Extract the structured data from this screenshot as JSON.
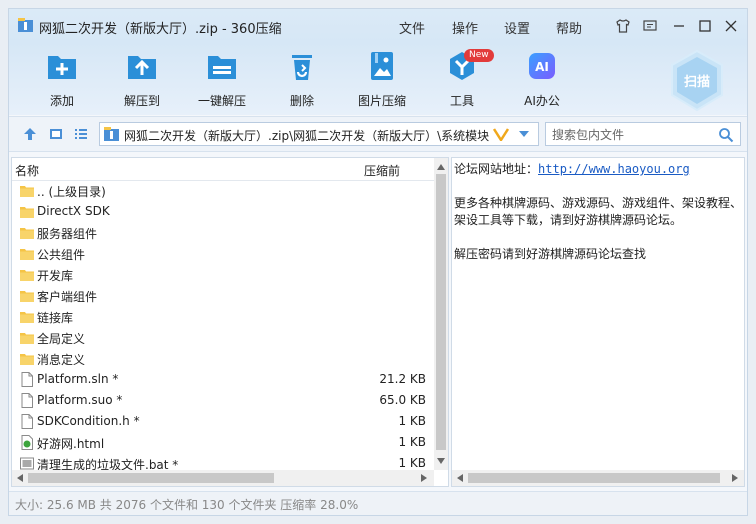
{
  "window": {
    "title": "网狐二次开发（新版大厅）.zip - 360压缩"
  },
  "menu": [
    "文件",
    "操作",
    "设置",
    "帮助"
  ],
  "toolbar": [
    {
      "label": "添加",
      "icon": "add-icon"
    },
    {
      "label": "解压到",
      "icon": "extract-to-icon"
    },
    {
      "label": "一键解压",
      "icon": "one-click-extract-icon"
    },
    {
      "label": "删除",
      "icon": "delete-icon"
    },
    {
      "label": "图片压缩",
      "icon": "image-compress-icon"
    },
    {
      "label": "工具",
      "icon": "tools-icon",
      "badge": "New"
    },
    {
      "label": "AI办公",
      "icon": "ai-office-icon",
      "glyph": "AI"
    }
  ],
  "scan": {
    "label": "扫描"
  },
  "nav": {
    "path": "网狐二次开发（新版大厅）.zip\\网狐二次开发（新版大厅）\\系统模块",
    "search_placeholder": "搜索包内文件"
  },
  "columns": {
    "name": "名称",
    "size": "压缩前"
  },
  "files": [
    {
      "name": ".. (上级目录)",
      "size": "",
      "type": "folder"
    },
    {
      "name": "DirectX SDK",
      "size": "",
      "type": "folder"
    },
    {
      "name": "服务器组件",
      "size": "",
      "type": "folder"
    },
    {
      "name": "公共组件",
      "size": "",
      "type": "folder"
    },
    {
      "name": "开发库",
      "size": "",
      "type": "folder"
    },
    {
      "name": "客户端组件",
      "size": "",
      "type": "folder"
    },
    {
      "name": "链接库",
      "size": "",
      "type": "folder"
    },
    {
      "name": "全局定义",
      "size": "",
      "type": "folder"
    },
    {
      "name": "消息定义",
      "size": "",
      "type": "folder"
    },
    {
      "name": "Platform.sln *",
      "size": "21.2 KB",
      "type": "file"
    },
    {
      "name": "Platform.suo *",
      "size": "65.0 KB",
      "type": "file"
    },
    {
      "name": "SDKCondition.h *",
      "size": "1 KB",
      "type": "file"
    },
    {
      "name": "好游网.html",
      "size": "1 KB",
      "type": "html"
    },
    {
      "name": "清理生成的垃圾文件.bat *",
      "size": "1 KB",
      "type": "bat"
    }
  ],
  "notes": {
    "line1_label": "论坛网站地址：",
    "line1_link": "http://www.haoyou.org",
    "line2": "更多各种棋牌源码、游戏源码、游戏组件、架设教程、",
    "line3": "架设工具等下载，请到好游棋牌源码论坛。",
    "line4": "解压密码请到好游棋牌源码论坛查找"
  },
  "status": "大小: 25.6 MB 共 2076 个文件和 130 个文件夹 压缩率 28.0%",
  "colors": {
    "accent": "#2b8fd8",
    "folder": "#f5c446"
  }
}
